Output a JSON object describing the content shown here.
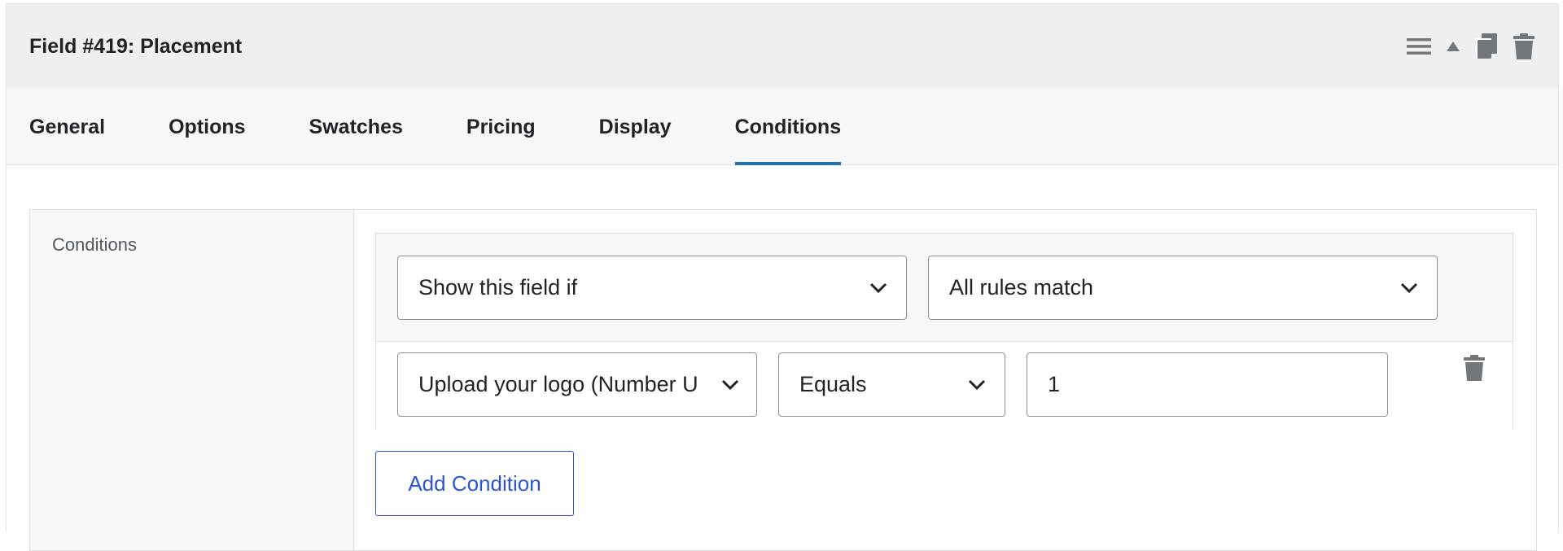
{
  "header": {
    "title": "Field #419: Placement",
    "actions": [
      {
        "icon": "menu-icon"
      },
      {
        "icon": "collapse-arrow-icon"
      },
      {
        "icon": "duplicate-icon"
      },
      {
        "icon": "trash-icon"
      }
    ]
  },
  "tabs": [
    {
      "label": "General",
      "active": false
    },
    {
      "label": "Options",
      "active": false
    },
    {
      "label": "Swatches",
      "active": false
    },
    {
      "label": "Pricing",
      "active": false
    },
    {
      "label": "Display",
      "active": false
    },
    {
      "label": "Conditions",
      "active": true
    }
  ],
  "conditions": {
    "label": "Conditions",
    "visibility_select": "Show this field if",
    "match_select": "All rules match",
    "rule": {
      "field_select": "Upload your logo (Number U",
      "operator_select": "Equals",
      "value": "1"
    },
    "add_button": "Add Condition"
  },
  "colors": {
    "accent": "#2271b1",
    "button_blue": "#2b55d6",
    "icon_gray": "#72777c"
  }
}
